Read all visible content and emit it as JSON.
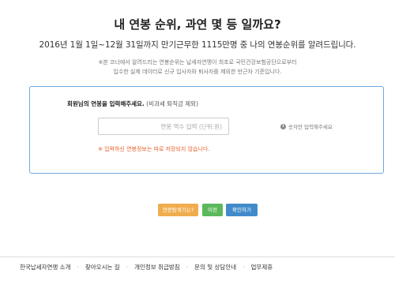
{
  "header": {
    "title": "내 연봉 순위, 과연 몇 등 일까요?",
    "subtitle": "2016년 1월 1일~12월 31일까지 만기근무한 1115만명 중 나의 연봉순위를 알려드립니다.",
    "note_line1": "※본 코너에서 알려드리는 연봉순위는 납세자연맹이 최초로 국민건강보험공단으로부터",
    "note_line2": "입수한 실제 데이터로 신규 입사자와 퇴사자를 제외한 만근자 기준입니다."
  },
  "form": {
    "label_strong": "회원님의 연봉을 입력해주세요.",
    "label_sub": "(비과세 퇴직금 제외)",
    "salary_input": {
      "value": "",
      "placeholder": "연봉 액수 입력 (단위:원)"
    },
    "hint": "숫자만 입력해주세요",
    "warning": "※ 입력하신 연봉정보는 따로 저장되지 않습니다."
  },
  "buttons": {
    "what_is_salary": "연봉탐색기는?",
    "prev": "이전",
    "confirm": "확인하기"
  },
  "footer": {
    "links": [
      "한국납세자연맹 소개",
      "찾아오시는 길",
      "개인정보 취급방침",
      "문의 및 상담안내",
      "업무제휴"
    ],
    "separator": "·"
  },
  "colors": {
    "panel_border": "#6fa8dc",
    "warning": "#e8622c",
    "btn_what": "#f0ad4e",
    "btn_prev": "#5cb85c",
    "btn_confirm": "#428bca"
  },
  "icons": {
    "hint_icon": "info-icon"
  }
}
